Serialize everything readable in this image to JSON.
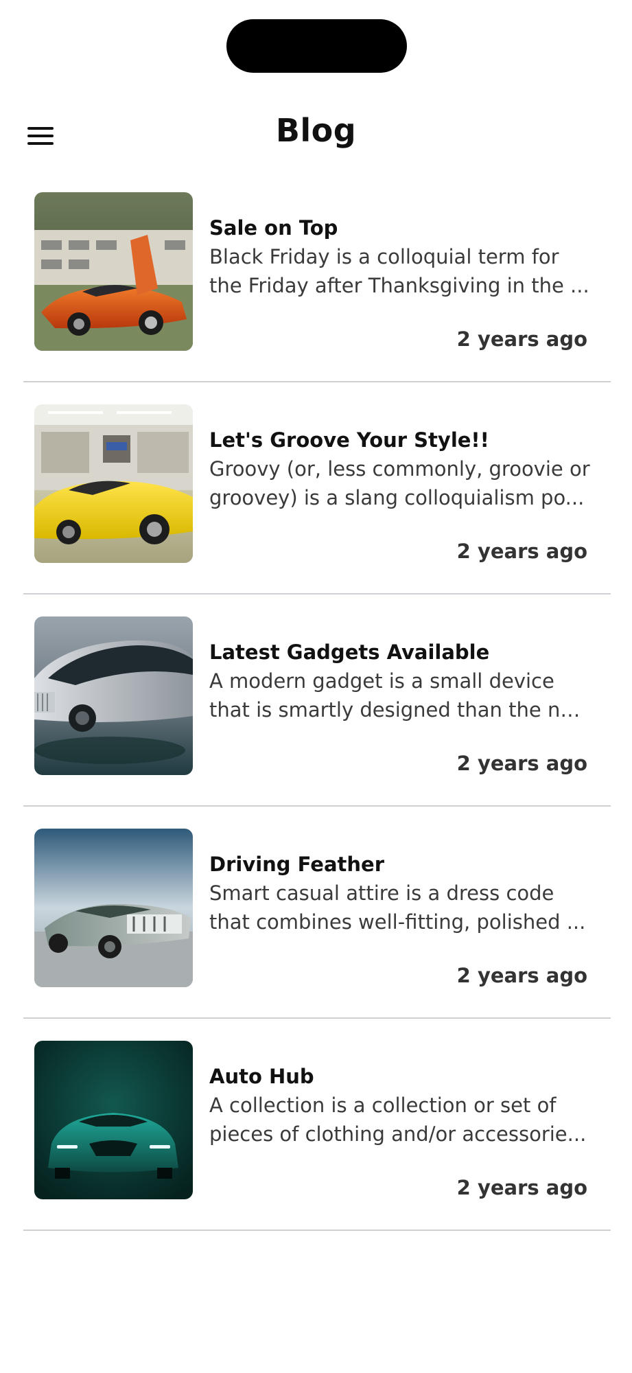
{
  "header": {
    "title": "Blog",
    "menu_icon": "hamburger-menu-icon"
  },
  "posts": [
    {
      "title": "Sale on Top",
      "excerpt_line1": "Black Friday is a colloquial term for",
      "excerpt_line2": "the Friday after Thanksgiving in the ...",
      "time": "2 years ago",
      "image": "orange sports car with open scissor doors"
    },
    {
      "title": "Let's Groove Your Style!!",
      "excerpt_line1": "Groovy (or, less commonly, groovie or",
      "excerpt_line2": "groovey) is a slang colloquialism po...",
      "time": "2 years ago",
      "image": "yellow sports car in showroom"
    },
    {
      "title": "Latest Gadgets Available",
      "excerpt_line1": "A modern gadget is a small device",
      "excerpt_line2": "that is smartly designed than the no...",
      "time": "2 years ago",
      "image": "silver concept car"
    },
    {
      "title": "Driving Feather",
      "excerpt_line1": "Smart casual attire is a dress code",
      "excerpt_line2": "that combines well-fitting, polished ...",
      "time": "2 years ago",
      "image": "futuristic concept car on road"
    },
    {
      "title": "Auto Hub",
      "excerpt_line1": "A collection is a collection or set of",
      "excerpt_line2": "pieces of clothing and/or accessorie...",
      "time": "2 years ago",
      "image": "teal sports car front view"
    }
  ]
}
